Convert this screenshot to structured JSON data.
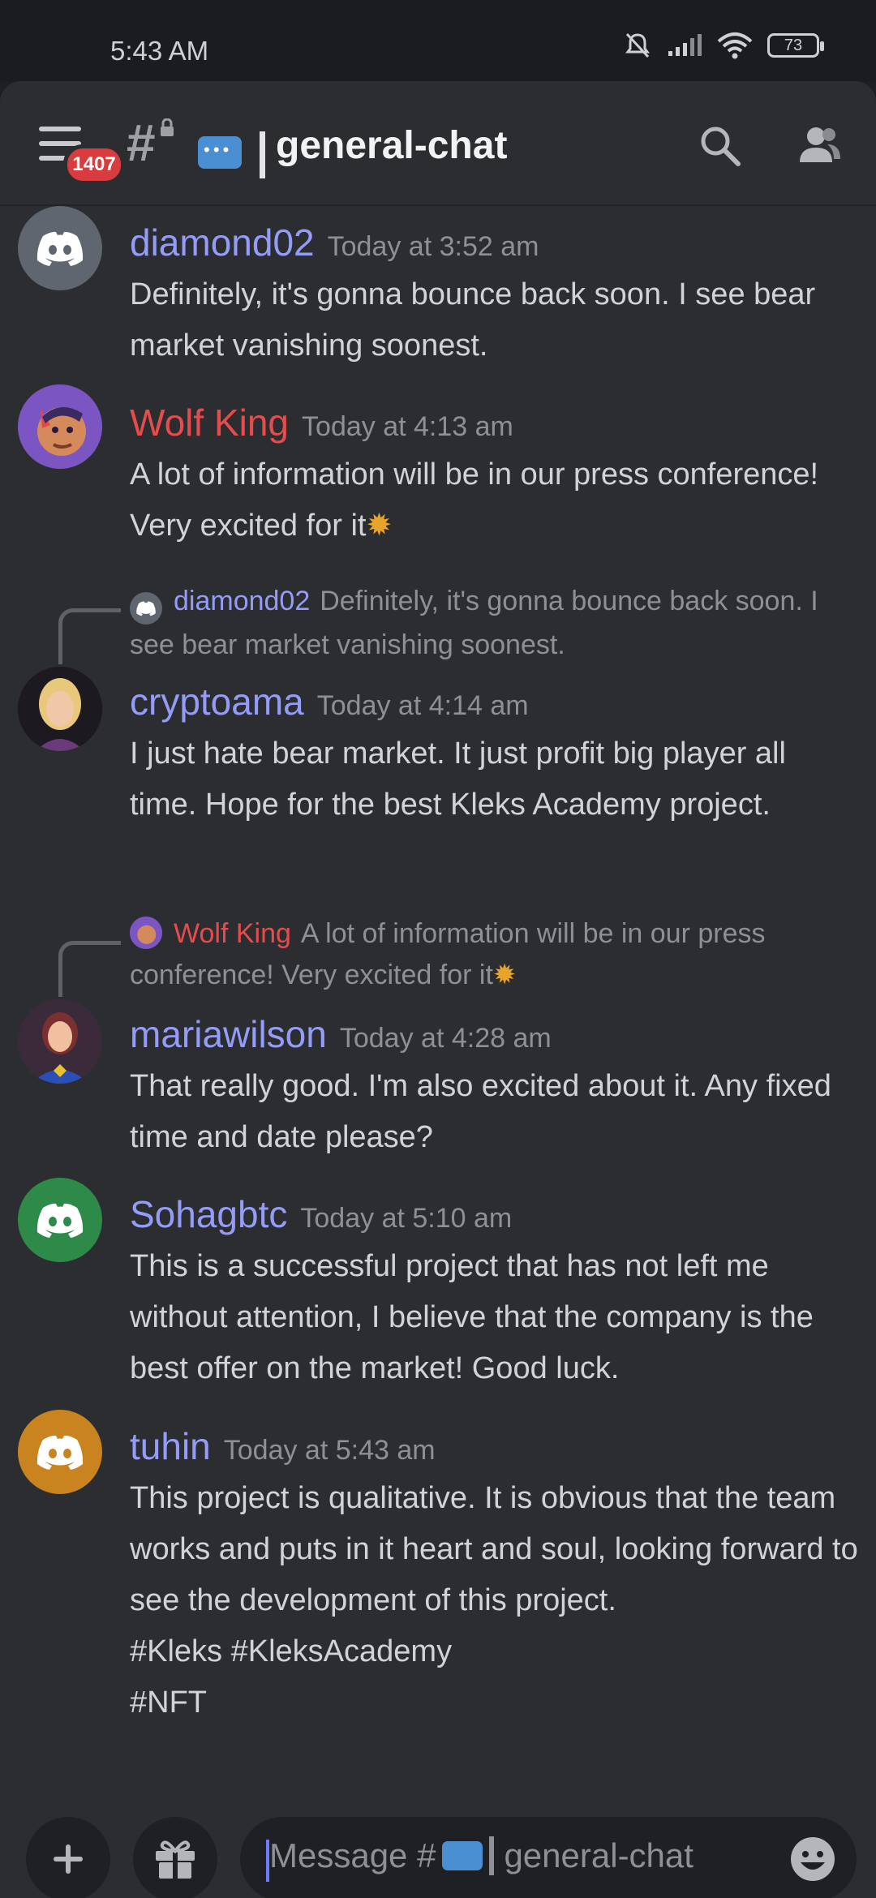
{
  "status_bar": {
    "time": "5:43 AM",
    "battery": "73"
  },
  "header": {
    "unread_badge": "1407",
    "channel_hash": "#",
    "channel_name": "general-chat"
  },
  "messages": [
    {
      "user": "diamond02",
      "time": "Today at 3:52 am",
      "text": "Definitely, it's gonna bounce back soon. I see bear market vanishing soonest.",
      "name_color": "#949cf7"
    },
    {
      "user": "Wolf King",
      "time": "Today at 4:13 am",
      "text": "A lot of information will be in our press conference! Very excited for it",
      "emoji": "✹",
      "name_color": "#e74c4c"
    },
    {
      "reply_to": "diamond02",
      "reply_text": "Definitely, it's gonna bounce back soon. I see bear market vanishing soonest.",
      "user": "cryptoama",
      "time": "Today at 4:14 am",
      "text": "I just hate bear market. It just profit big player all time. Hope for the best Kleks Academy project.",
      "name_color": "#949cf7"
    },
    {
      "reply_to": "Wolf King",
      "reply_text": "A lot of information will be in our press conference! Very excited for it",
      "user": "mariawilson",
      "time": "Today at 4:28 am",
      "text": "That really good. I'm also excited about it. Any fixed time and date please?",
      "name_color": "#949cf7"
    },
    {
      "user": "Sohagbtc",
      "time": "Today at 5:10 am",
      "text": "This is a successful project that has not left me without attention, I believe that the company is the best offer on the market! Good luck.",
      "name_color": "#949cf7"
    },
    {
      "user": "tuhin",
      "time": "Today at 5:43 am",
      "text": "This project is qualitative. It is obvious that the team works and puts in it heart and soul, looking forward to see the development of this project.",
      "tags": [
        "#Kleks #KleksAcademy",
        "#NFT"
      ],
      "name_color": "#949cf7"
    }
  ],
  "composer": {
    "placeholder_prefix": "Message #",
    "placeholder_channel": "general-chat"
  },
  "colors": {
    "accent": "#949cf7",
    "danger": "#e74c4c",
    "background": "#2b2d31"
  }
}
